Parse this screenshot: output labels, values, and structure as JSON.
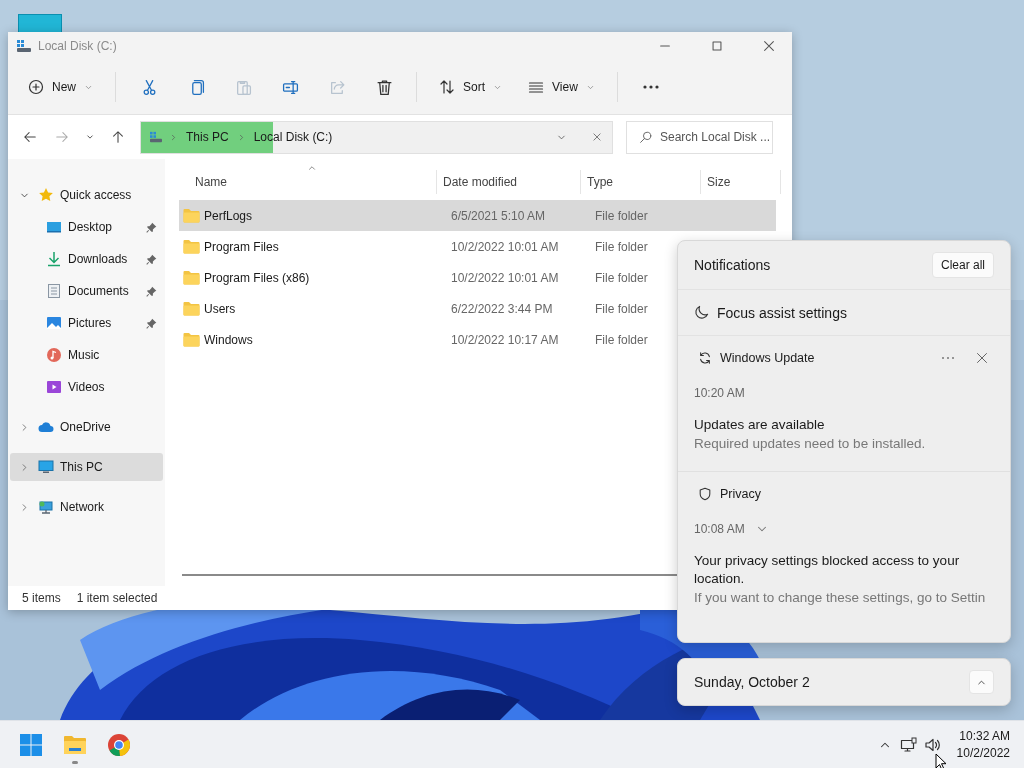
{
  "window": {
    "title": "Local Disk (C:)",
    "toolbar": [
      {
        "kind": "menu",
        "label": "New",
        "disabled": false
      },
      {
        "kind": "separator"
      },
      {
        "kind": "icon",
        "disabled": false
      },
      {
        "kind": "icon",
        "disabled": false
      },
      {
        "kind": "icon",
        "disabled": true
      },
      {
        "kind": "icon",
        "disabled": false
      },
      {
        "kind": "icon",
        "disabled": true
      },
      {
        "kind": "icon",
        "disabled": false
      },
      {
        "kind": "separator"
      },
      {
        "kind": "menu",
        "label": "Sort",
        "disabled": false
      },
      {
        "kind": "menu",
        "label": "View",
        "disabled": false
      },
      {
        "kind": "separator"
      },
      {
        "kind": "more",
        "disabled": false
      }
    ],
    "nav_buttons": [
      {
        "disabled": false
      },
      {
        "disabled": true
      },
      {
        "disabled": false
      },
      {
        "disabled": false
      }
    ],
    "address": {
      "segments": [
        "This PC",
        "Local Disk (C:)"
      ],
      "progress": {
        "level": 0.28
      }
    },
    "search": {
      "placeholder": "Search Local Disk ..."
    },
    "sidebar": {
      "items": [
        {
          "label": "Quick access",
          "expanded": true,
          "selected": false,
          "children": [
            {
              "label": "Desktop",
              "pinned": true,
              "selected": false
            },
            {
              "label": "Downloads",
              "pinned": true,
              "selected": false
            },
            {
              "label": "Documents",
              "pinned": true,
              "selected": false
            },
            {
              "label": "Pictures",
              "pinned": true,
              "selected": false
            },
            {
              "label": "Music",
              "pinned": false,
              "selected": false
            },
            {
              "label": "Videos",
              "pinned": false,
              "selected": false
            }
          ]
        },
        {
          "label": "OneDrive",
          "expanded": false,
          "selected": false
        },
        {
          "label": "This PC",
          "expanded": false,
          "selected": true
        },
        {
          "label": "Network",
          "expanded": false,
          "selected": false
        }
      ]
    },
    "files": {
      "columns": [
        {
          "label": "Name",
          "sorted": true
        },
        {
          "label": "Date modified",
          "sorted": false
        },
        {
          "label": "Type",
          "sorted": false
        },
        {
          "label": "Size",
          "sorted": false
        }
      ],
      "rows": [
        {
          "name": "PerfLogs",
          "date": "6/5/2021 5:10 AM",
          "type": "File folder",
          "selected": true
        },
        {
          "name": "Program Files",
          "date": "10/2/2022 10:01 AM",
          "type": "File folder",
          "selected": false
        },
        {
          "name": "Program Files (x86)",
          "date": "10/2/2022 10:01 AM",
          "type": "File folder",
          "selected": false
        },
        {
          "name": "Users",
          "date": "6/22/2022 3:44 PM",
          "type": "File folder",
          "selected": false
        },
        {
          "name": "Windows",
          "date": "10/2/2022 10:17 AM",
          "type": "File folder",
          "selected": false
        }
      ]
    },
    "status_bar": [
      "5 items",
      "1 item selected"
    ]
  },
  "notifications": {
    "title": "Notifications",
    "clear_button": "Clear all",
    "focus_assist": "Focus assist settings",
    "items": [
      {
        "app": "Windows Update",
        "time": "10:20 AM",
        "title": "Updates are available",
        "body": "Required updates need to be installed.",
        "show_actions": true,
        "collapsible": false
      },
      {
        "app": "Privacy",
        "time": "10:08 AM",
        "title": "Your privacy settings blocked access to your location.",
        "body": "If you want to change these settings, go to Settin",
        "show_actions": false,
        "collapsible": true
      }
    ]
  },
  "calendar": {
    "date": "Sunday, October 2",
    "expanded": false
  },
  "taskbar": {
    "apps": [
      {
        "running": false
      },
      {
        "running": true
      },
      {
        "running": false
      }
    ],
    "time": "10:32 AM",
    "date": "10/2/2022"
  }
}
